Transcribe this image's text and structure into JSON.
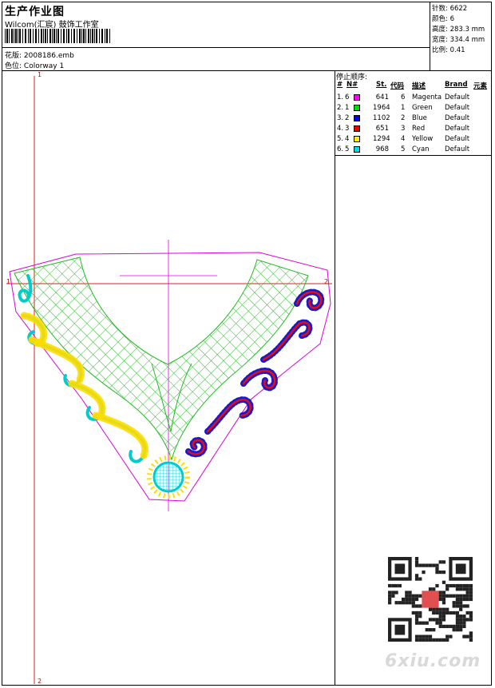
{
  "header": {
    "title": "生产作业图",
    "studio": "Wilcom(汇宸) 鼓饰工作室",
    "design_label": "花版:",
    "design_file": "2008186.emb",
    "colorway_label": "色位:",
    "colorway": "Colorway 1"
  },
  "stats": [
    {
      "label": "针数:",
      "value": "6622"
    },
    {
      "label": "颜色:",
      "value": "6"
    },
    {
      "label": "高度:",
      "value": "283.3 mm"
    },
    {
      "label": "宽度:",
      "value": "334.4 mm"
    },
    {
      "label": "比例:",
      "value": "0.41"
    }
  ],
  "stop_sequence": {
    "title": "停止顺序:",
    "headers": {
      "stop": "#",
      "n": "N#",
      "st": "St.",
      "code": "代码",
      "desc": "描述",
      "brand": "Brand",
      "element": "元素"
    },
    "rows": [
      {
        "stop": "1.",
        "n": "6",
        "color": "#ff00ff",
        "st": "641",
        "code": "6",
        "desc": "Magenta",
        "brand": "Default"
      },
      {
        "stop": "2.",
        "n": "1",
        "color": "#00dd00",
        "st": "1964",
        "code": "1",
        "desc": "Green",
        "brand": "Default"
      },
      {
        "stop": "3.",
        "n": "2",
        "color": "#0000ee",
        "st": "1102",
        "code": "2",
        "desc": "Blue",
        "brand": "Default"
      },
      {
        "stop": "4.",
        "n": "3",
        "color": "#ee0000",
        "st": "651",
        "code": "3",
        "desc": "Red",
        "brand": "Default"
      },
      {
        "stop": "5.",
        "n": "4",
        "color": "#ffee00",
        "st": "1294",
        "code": "4",
        "desc": "Yellow",
        "brand": "Default"
      },
      {
        "stop": "6.",
        "n": "5",
        "color": "#00dddd",
        "st": "968",
        "code": "5",
        "desc": "Cyan",
        "brand": "Default"
      }
    ]
  },
  "markers": {
    "top_left": "1",
    "left": "1",
    "right": "2",
    "bottom": "2"
  },
  "watermark": "6xiu.com",
  "colors": {
    "guide": "#dd2222",
    "outline": "#dd00dd",
    "green": "#22bb22",
    "cyan": "#00cccc",
    "yellow": "#ffdd00",
    "blue": "#1a1acc",
    "red": "#e01010"
  }
}
